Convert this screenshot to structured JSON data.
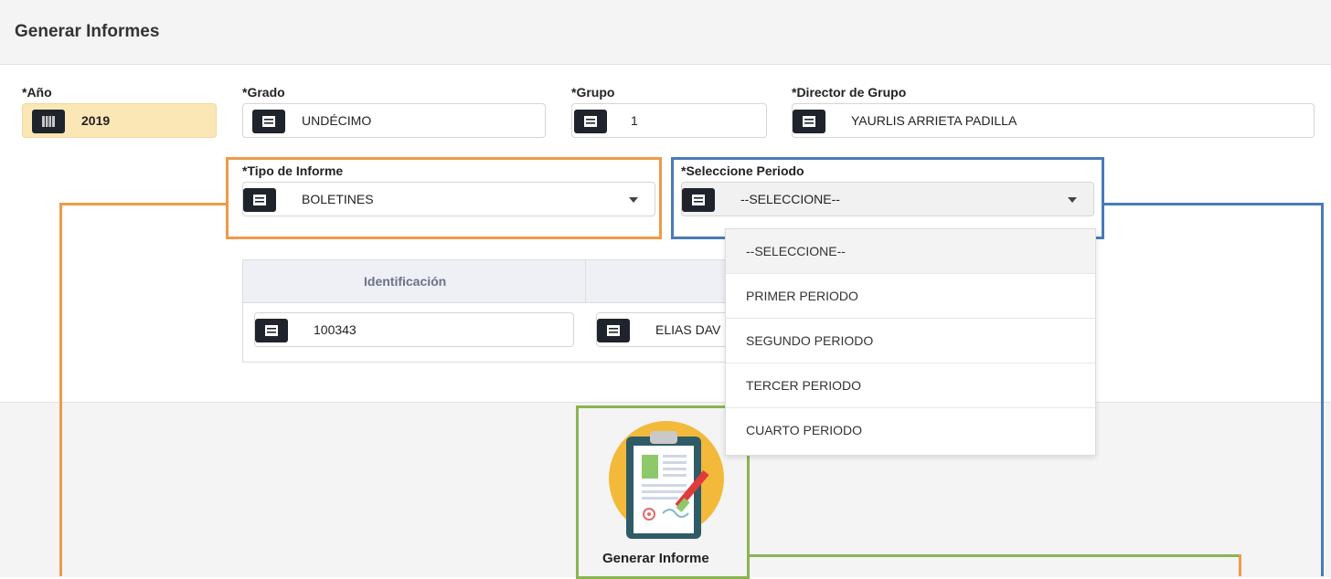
{
  "header": {
    "title": "Generar Informes"
  },
  "fields": {
    "year": {
      "label": "*Año",
      "value": "2019"
    },
    "grade": {
      "label": "*Grado",
      "value": "UNDÉCIMO"
    },
    "group": {
      "label": "*Grupo",
      "value": "1"
    },
    "director": {
      "label": "*Director de Grupo",
      "value": "YAURLIS ARRIETA PADILLA"
    },
    "report_type": {
      "label": "*Tipo de Informe",
      "value": "BOLETINES"
    },
    "period": {
      "label": "*Seleccione Periodo",
      "value": "--SELECCIONE--"
    }
  },
  "period_options": [
    "--SELECCIONE--",
    "PRIMER PERIODO",
    "SEGUNDO PERIODO",
    "TERCER PERIODO",
    "CUARTO PERIODO"
  ],
  "table": {
    "headers": [
      "Identificación",
      ""
    ],
    "row": {
      "identification": "100343",
      "name": "ELIAS DAV"
    }
  },
  "generate": {
    "label": "Generar Informe"
  },
  "colors": {
    "orange": "#f09a48",
    "blue": "#4a7ab8",
    "green": "#8ab452",
    "addon": "#1f232b"
  }
}
